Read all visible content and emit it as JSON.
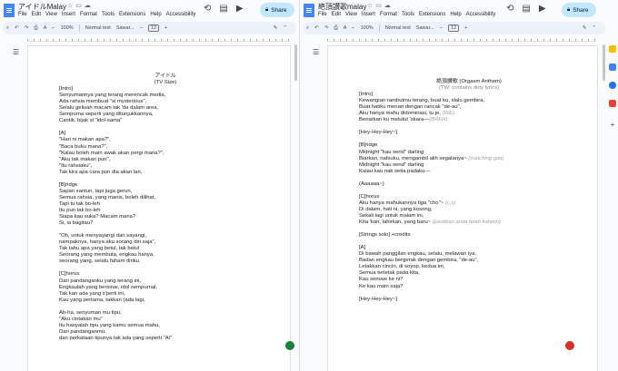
{
  "left": {
    "title": "アイドルMalay",
    "menu": [
      "File",
      "Edit",
      "View",
      "Insert",
      "Format",
      "Tools",
      "Extensions",
      "Help",
      "Accessibility"
    ],
    "share": "Share",
    "toolbar": {
      "zoom": "100%",
      "style": "Normal text",
      "font": "Sawar...",
      "size": "12"
    },
    "lines": [
      {
        "t": "アイドル",
        "c": "center"
      },
      {
        "t": "(TV Size)",
        "c": "center"
      },
      {
        "t": "[Intro]"
      },
      {
        "t": "Senyumannya yang terang merencak media,"
      },
      {
        "t": "Ada rahsia membuat \"si mysterious\","
      },
      {
        "t": "Selalu gelisah macam tak 'da dalam area,"
      },
      {
        "t": "Sempurna seperti yang ditunjukkannya,"
      },
      {
        "t": "Cantik, bijak si \"idol-sama\""
      },
      {
        "t": ""
      },
      {
        "t": "[A]"
      },
      {
        "t": "\"Hari ni makan apa?\","
      },
      {
        "t": "\"Baca buku mana?\","
      },
      {
        "t": "\"Kalau boleh main awak akan pergi mana?\","
      },
      {
        "t": "\"Aku tak makan pun\","
      },
      {
        "t": "\"Itu rahsiaku\","
      },
      {
        "t": "Tak kira apa cara pun dia akan lari,"
      },
      {
        "t": ""
      },
      {
        "t": "[B]ridge"
      },
      {
        "t": "Sapan santun, tapi juga gerun,"
      },
      {
        "t": "Semua rahsia, yang manis, boleh dilihat,"
      },
      {
        "t": "Tapi tu tak bo-leh"
      },
      {
        "t": "Itu pun tak bo-leh"
      },
      {
        "t": "Siapa kau suka? Macam mana?"
      },
      {
        "t": "Si, ia bagitau?"
      },
      {
        "t": ""
      },
      {
        "t": "\"Oh, untuk menyayangi dan sayangi,"
      },
      {
        "t": "nampaknya, hanya aku sorang diri saja\","
      },
      {
        "t": "Tak tahu apa yang betul, tak betul"
      },
      {
        "t": "Seorang yang membuta, engkau hanya,"
      },
      {
        "t": "seorang yang, selalu faham diriku"
      },
      {
        "t": ""
      },
      {
        "t": "[C]horus"
      },
      {
        "t": "Dari pandanganku yang terang ini,"
      },
      {
        "t": "Engkaulah yang bersinar, idol sempurnal,"
      },
      {
        "t": "Tak kan ada yang s'perti ini,"
      },
      {
        "t": "Kau yang pertama, takkan (ada lagi,"
      },
      {
        "t": ""
      },
      {
        "t": "Ah-ha, senyuman mu tipu,"
      },
      {
        "t": "\"Aku cintakan mu\""
      },
      {
        "t": "Itu hanyalah tipu yang kamu semua mahu,"
      },
      {
        "t": "Dari pandanganmu,"
      },
      {
        "t": "dan perkataan tipunya tak ada yang seperti \"Ai\""
      }
    ]
  },
  "right": {
    "title": "絶頂讃歌malay",
    "menu": [
      "File",
      "Edit",
      "View",
      "Insert",
      "Format",
      "Tools",
      "Extensions",
      "Help",
      "Accessibility"
    ],
    "share": "Share",
    "toolbar": {
      "zoom": "100%",
      "style": "Normal text",
      "font": "Sawar...",
      "size": "12"
    },
    "lines": [
      {
        "t": "絶頂讃歌 (Orgasm Anthem)",
        "c": "center"
      },
      {
        "t": "(TW: contains dirty lyrics)",
        "c": "center sub"
      },
      {
        "t": "[Intro]"
      },
      {
        "t": "Kewangian rambutmu terang, buat ku, slalu gembira,"
      },
      {
        "t": "Buat hatiku menari dengan rancak \"de-au\","
      },
      {
        "t": "Aku hanya mahu didominasi, tu je, ",
        "g": "(WE)"
      },
      {
        "t": "Benarkan ku melutut 'skarа—",
        "g": "(BREH)"
      },
      {
        "t": ""
      },
      {
        "t": "[Hey-Hey-Hey~]"
      },
      {
        "t": ""
      },
      {
        "t": "[B]ridge"
      },
      {
        "t": "Midnight \"kau send\" darling"
      },
      {
        "t": "Biarkan, nafsuku, mengambil alih segalanya~ ",
        "g": "(matching gda)"
      },
      {
        "t": "Midnight \"kau send\" darling"
      },
      {
        "t": "Kalau kau nak setia padaku—"
      },
      {
        "t": ""
      },
      {
        "t": "(Aaaaaa~)"
      },
      {
        "t": ""
      },
      {
        "t": "[C]horus"
      },
      {
        "t": "Aku hanya mahukannya tiga \"cho\"~ ",
        "g": "(c,s)"
      },
      {
        "t": "Di dalam, hati ni, yang kosong,"
      },
      {
        "t": "Sekali lagi untuk malam ini,"
      },
      {
        "t": "Kita 'kan, lahirkan, yang baru~ ",
        "g": "(pastikan anda telah kahwin)"
      },
      {
        "t": ""
      },
      {
        "t": "[Strings solo] +credits"
      },
      {
        "t": ""
      },
      {
        "t": "[A]"
      },
      {
        "t": "Di bawah panggilan engkau, selalu, melawan iya,"
      },
      {
        "t": "Badan engkau bergerak dengan gembira, \"de-au\","
      },
      {
        "t": "Letakkan cincin, di soyop, kedua ini,"
      },
      {
        "t": "Semua terletak pada kita,"
      },
      {
        "t": "Kau serious ke ni?"
      },
      {
        "t": "Ke kau main saja?"
      },
      {
        "t": ""
      },
      {
        "t": "[Hey-Hey-Hey~]"
      }
    ]
  },
  "icons": {
    "doc": "google-docs-icon",
    "star": "star-icon",
    "folder": "move-folder-icon",
    "cloud": "cloud-saved-icon",
    "history": "history-icon",
    "comment": "comment-icon",
    "meet": "meet-icon",
    "lock": "lock-icon",
    "undo": "undo-icon",
    "redo": "redo-icon",
    "print": "print-icon",
    "spell": "spellcheck-icon",
    "paint": "paint-format-icon",
    "edit": "editing-mode-icon",
    "outline": "outline-icon"
  },
  "colors": {
    "share_bg": "#c2e7ff",
    "doc_blue": "#4285f4",
    "fab_green": "#188038",
    "fab_red": "#d93025"
  }
}
